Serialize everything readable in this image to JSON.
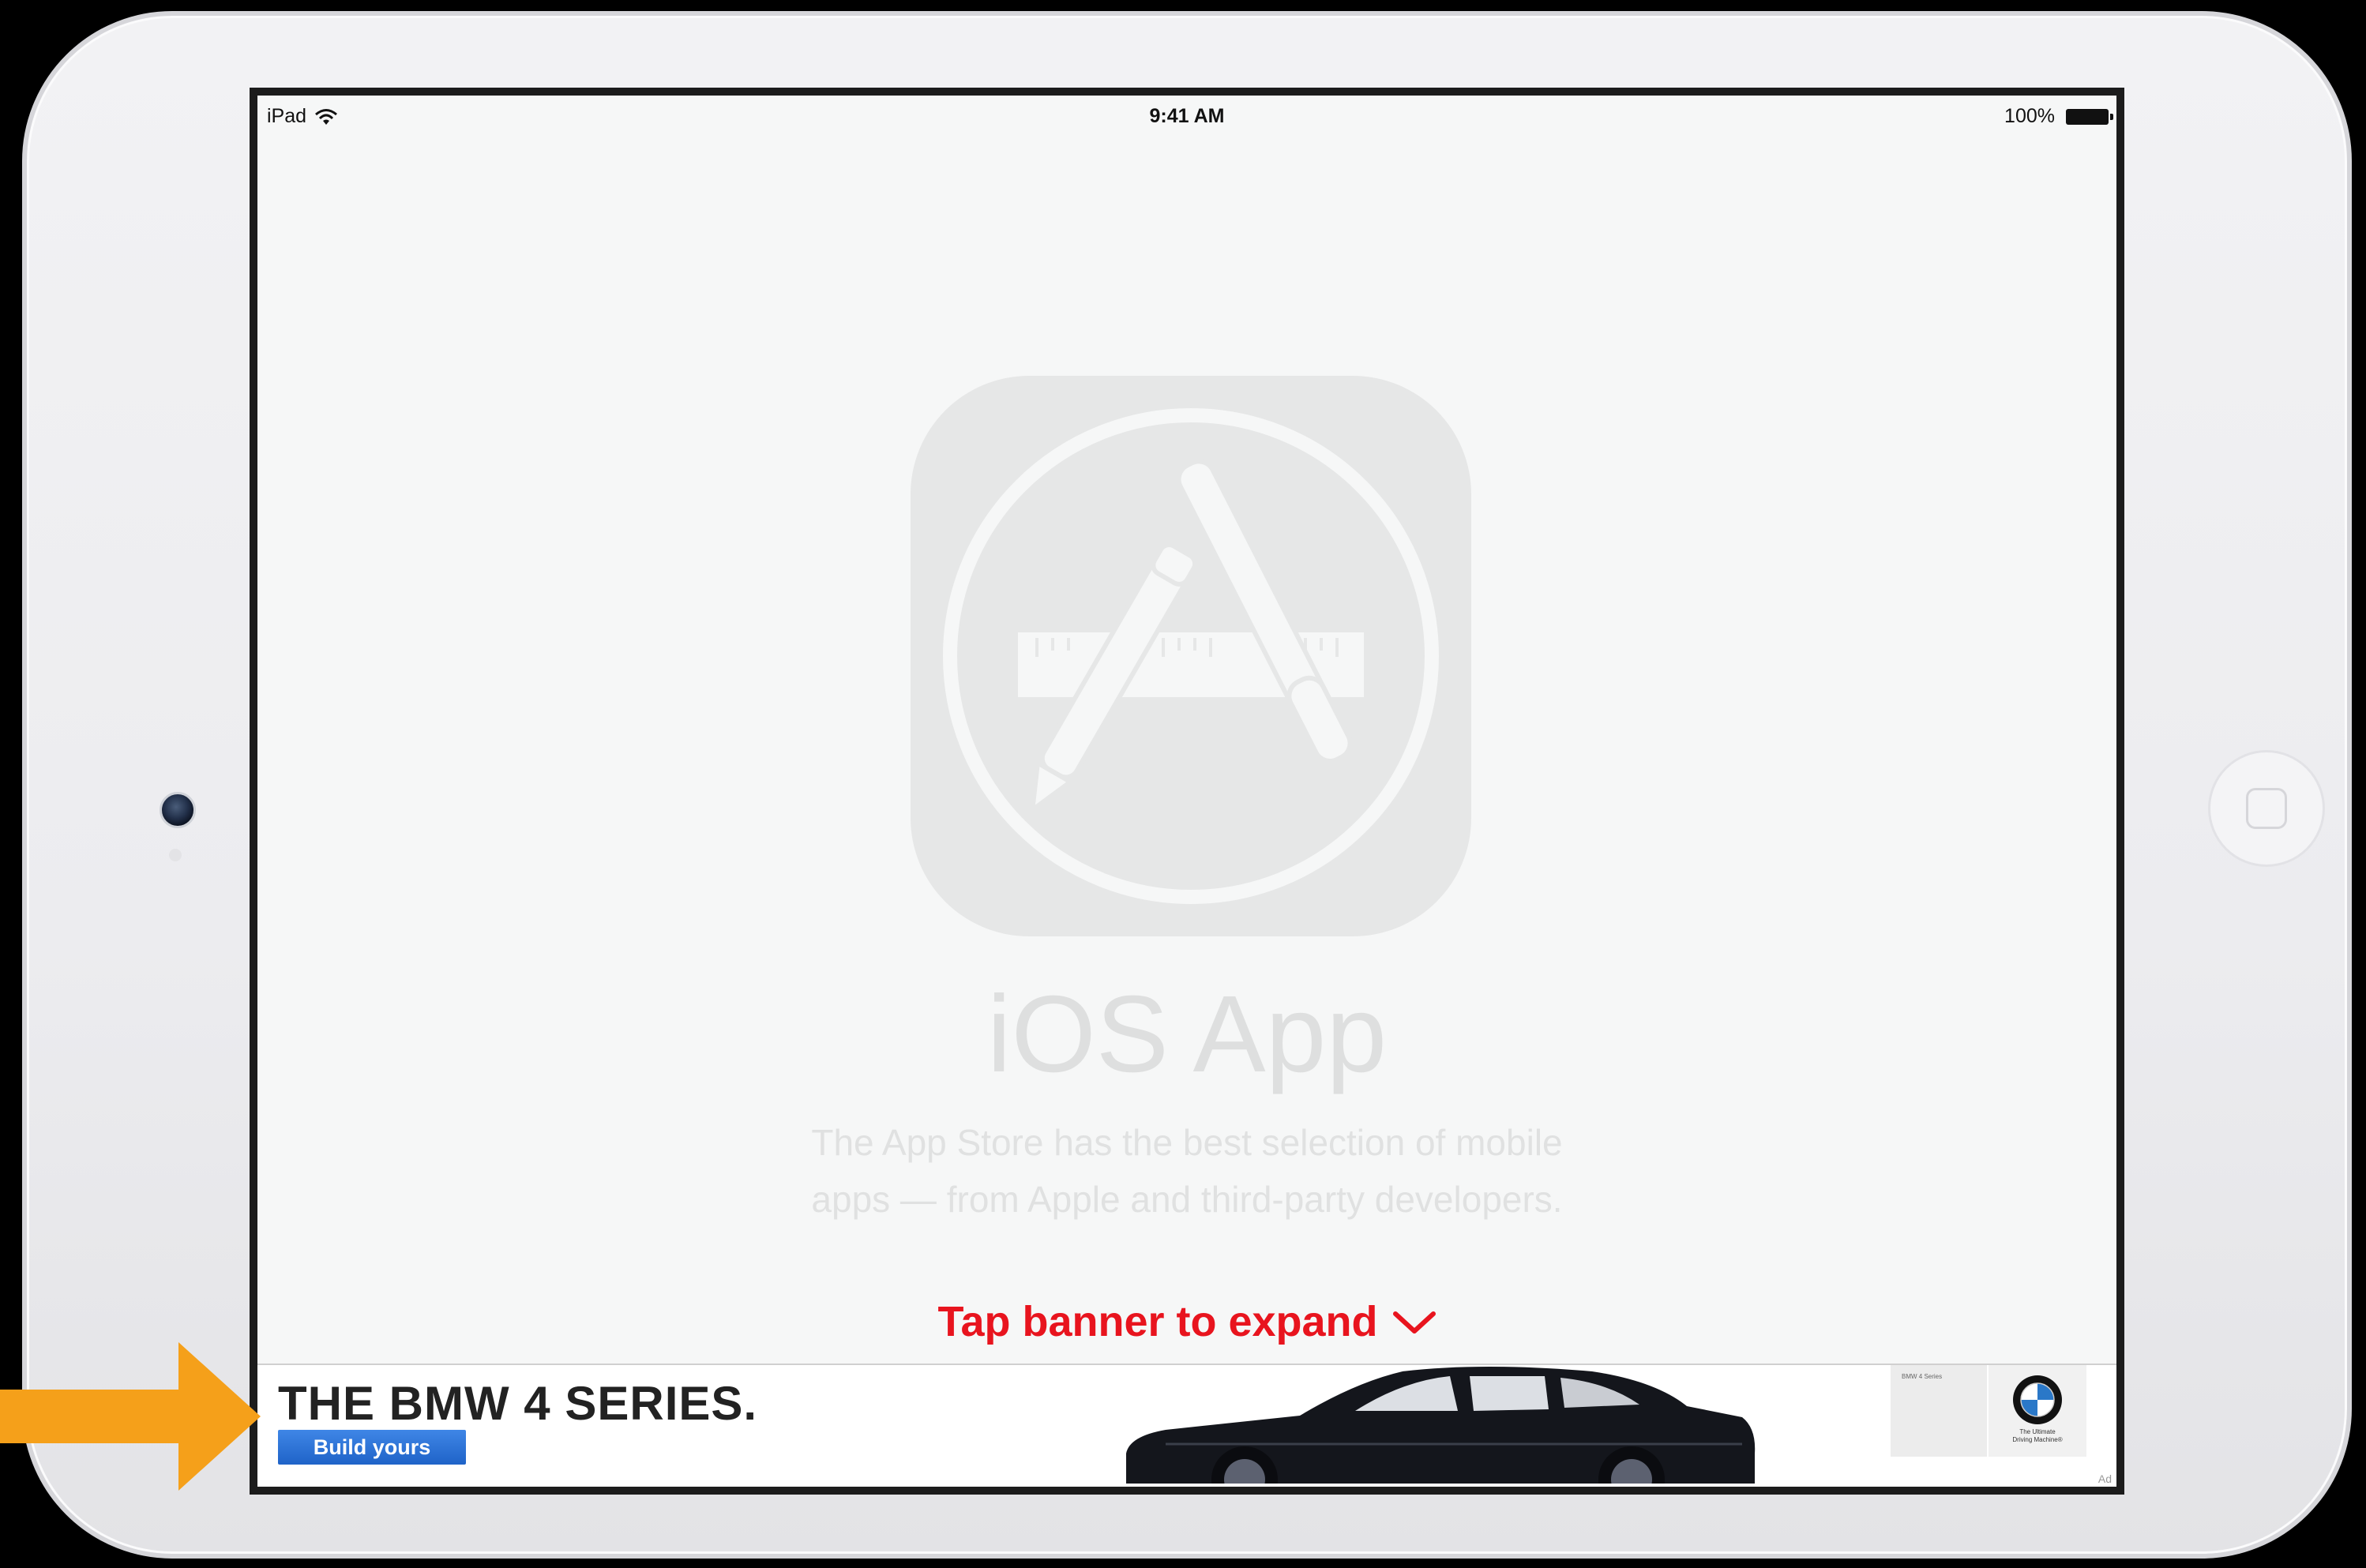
{
  "status_bar": {
    "device": "iPad",
    "time": "9:41 AM",
    "battery": "100%"
  },
  "app_placeholder": {
    "title": "iOS App",
    "description_line1": "The App Store has the best selection of mobile",
    "description_line2": "apps — from Apple  and third-party developers."
  },
  "hint": {
    "text": "Tap banner to expand"
  },
  "banner": {
    "headline": "THE BMW 4 SERIES.",
    "button_label": "Build yours",
    "tile_text": "BMW 4 Series",
    "tagline_line1": "The Ultimate",
    "tagline_line2": "Driving Machine®",
    "ad_label": "Ad"
  },
  "colors": {
    "hint": "#e8141e",
    "banner_button": "#2b6fd6",
    "arrow": "#f5a01a"
  }
}
